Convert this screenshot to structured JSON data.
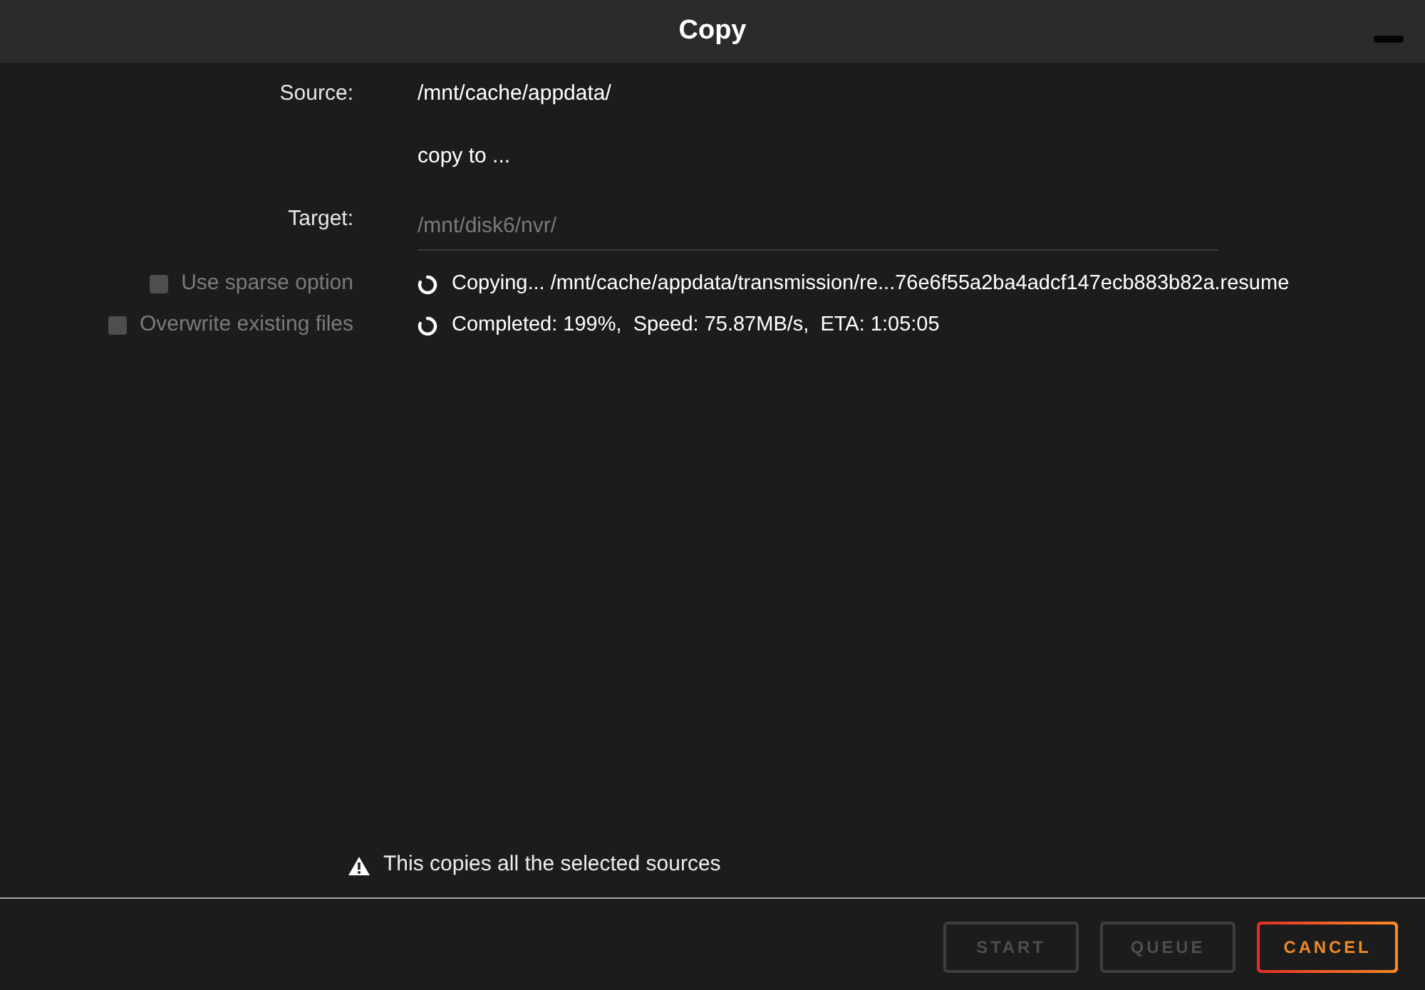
{
  "window": {
    "title": "Copy"
  },
  "form": {
    "source": {
      "label": "Source:",
      "value": "/mnt/cache/appdata/"
    },
    "action": "copy to ...",
    "target": {
      "label": "Target:",
      "value": "/mnt/disk6/nvr/",
      "disabled": true
    }
  },
  "options": [
    {
      "label": "Use sparse option",
      "checked": false,
      "disabled": true
    },
    {
      "label": "Overwrite existing files",
      "checked": false,
      "disabled": true
    }
  ],
  "progress": [
    "Copying... /mnt/cache/appdata/transmission/re...76e6f55a2ba4adcf147ecb883b82a.resume",
    "Completed: 199%,  Speed: 75.87MB/s,  ETA: 1:05:05"
  ],
  "note": "This copies all the selected sources",
  "buttons": [
    {
      "label": "START",
      "disabled": true
    },
    {
      "label": "QUEUE",
      "disabled": true
    },
    {
      "label": "CANCEL",
      "disabled": false
    }
  ]
}
